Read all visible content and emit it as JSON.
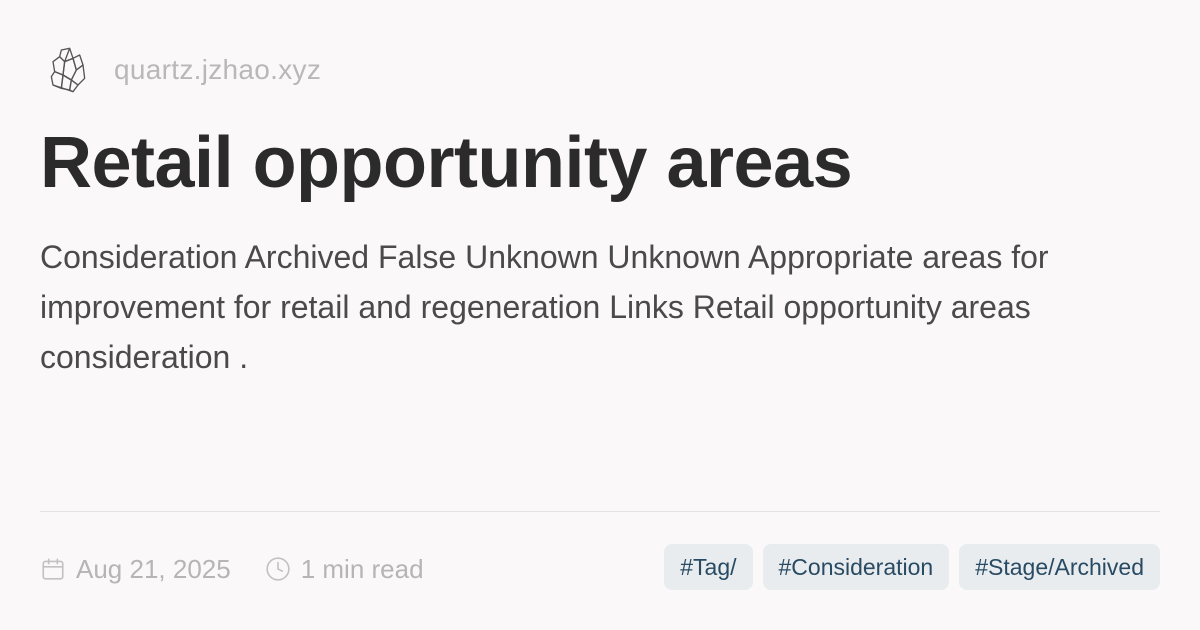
{
  "site": {
    "logo_icon": "crystal-icon",
    "name": "quartz.jzhao.xyz"
  },
  "page": {
    "title": "Retail opportunity areas",
    "description": "Consideration Archived False Unknown Unknown Appropriate areas for improvement for retail and regeneration Links Retail opportunity areas consideration ."
  },
  "meta": {
    "date_icon": "calendar-icon",
    "date": "Aug 21, 2025",
    "reading_icon": "clock-icon",
    "reading_time": "1 min read"
  },
  "tags": [
    "#Tag/",
    "#Consideration",
    "#Stage/Archived"
  ],
  "colors": {
    "background": "#faf8f8",
    "title": "#2b2b2b",
    "muted": "#b5b5b5",
    "tag_bg": "#e9ecef",
    "tag_text": "#284b63"
  }
}
